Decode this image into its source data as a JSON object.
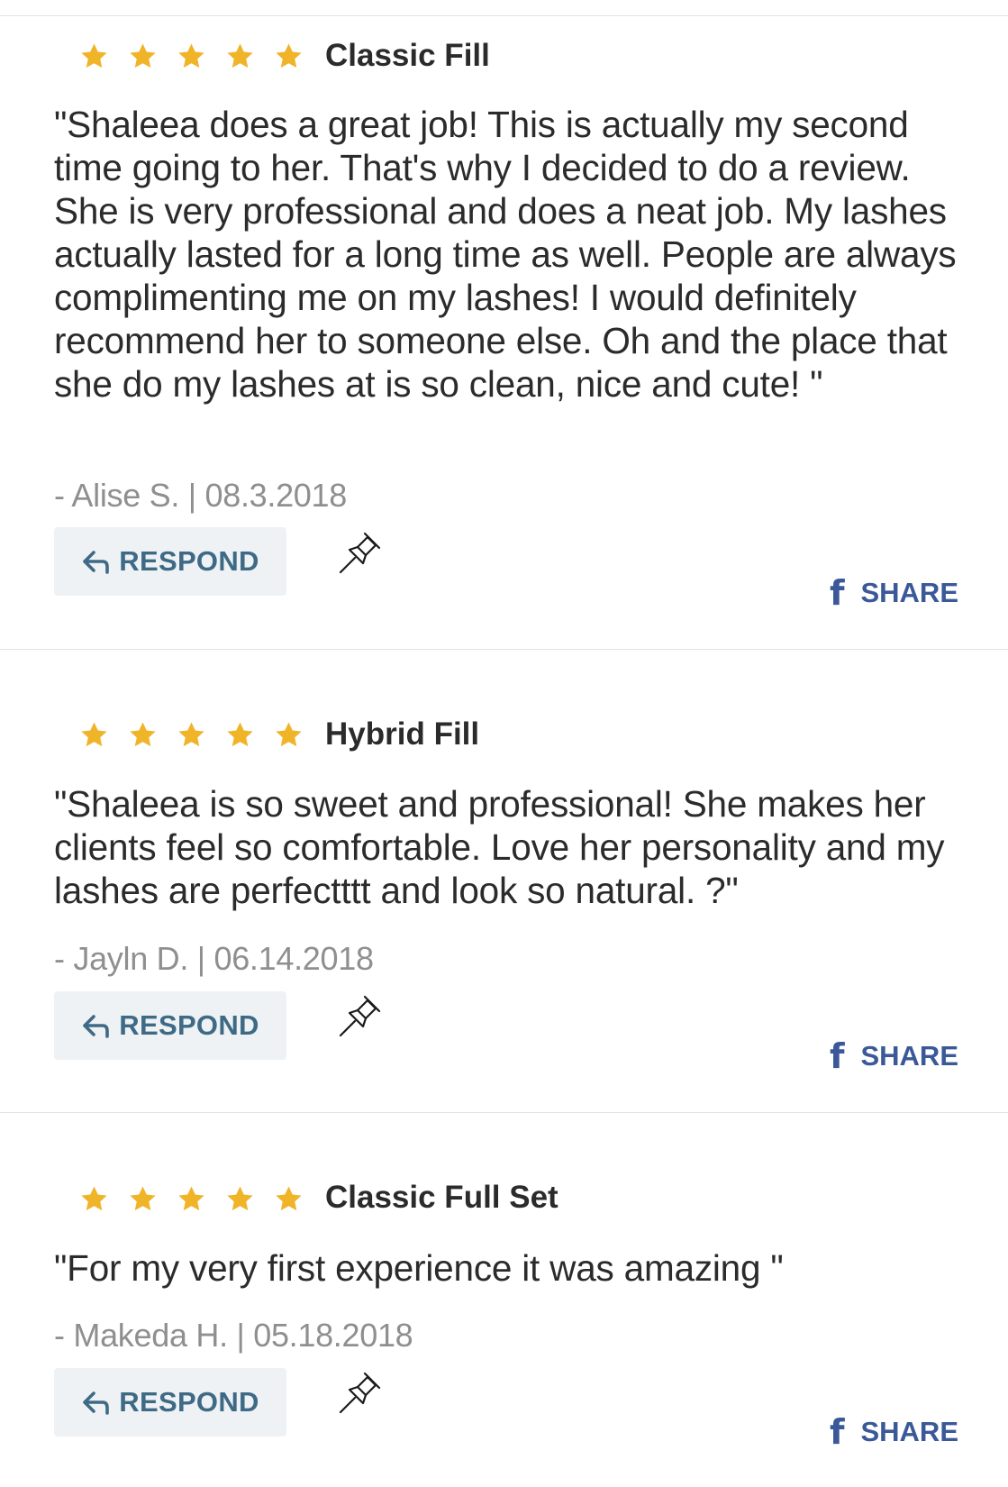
{
  "reviews": [
    {
      "rating": 5,
      "service": "Classic Fill",
      "text": "\"Shaleea does a great job! This is actually my second time going to her. That's why I decided to do a review. She is very professional and does a neat job. My lashes actually lasted for a long time as well. People are always complimenting me on my lashes! I would definitely recommend her to someone else. Oh and the place that she do my lashes at is so clean, nice and cute! \"",
      "meta": "- Alise S. | 08.3.2018",
      "respond_label": "RESPOND",
      "share_label": "SHARE"
    },
    {
      "rating": 5,
      "service": "Hybrid Fill",
      "text": "\"Shaleea is so sweet and professional! She makes her clients feel so comfortable. Love her personality and my lashes are perfectttt and look so natural. ?\"",
      "meta": "- Jayln D. | 06.14.2018",
      "respond_label": "RESPOND",
      "share_label": "SHARE"
    },
    {
      "rating": 5,
      "service": "Classic Full Set",
      "text": "\"For my very first experience it was amazing \"",
      "meta": "- Makeda H. | 05.18.2018",
      "respond_label": "RESPOND",
      "share_label": "SHARE"
    }
  ],
  "icons": {
    "star": "star-icon",
    "respond": "reply-arrow-icon",
    "pin": "pushpin-icon",
    "share": "facebook-icon"
  },
  "colors": {
    "star": "#f0b429",
    "respond_text": "#3e6a85",
    "respond_bg": "#eef2f5",
    "share": "#3b5998",
    "meta": "#8f8f8f",
    "text": "#2b2b2b"
  }
}
